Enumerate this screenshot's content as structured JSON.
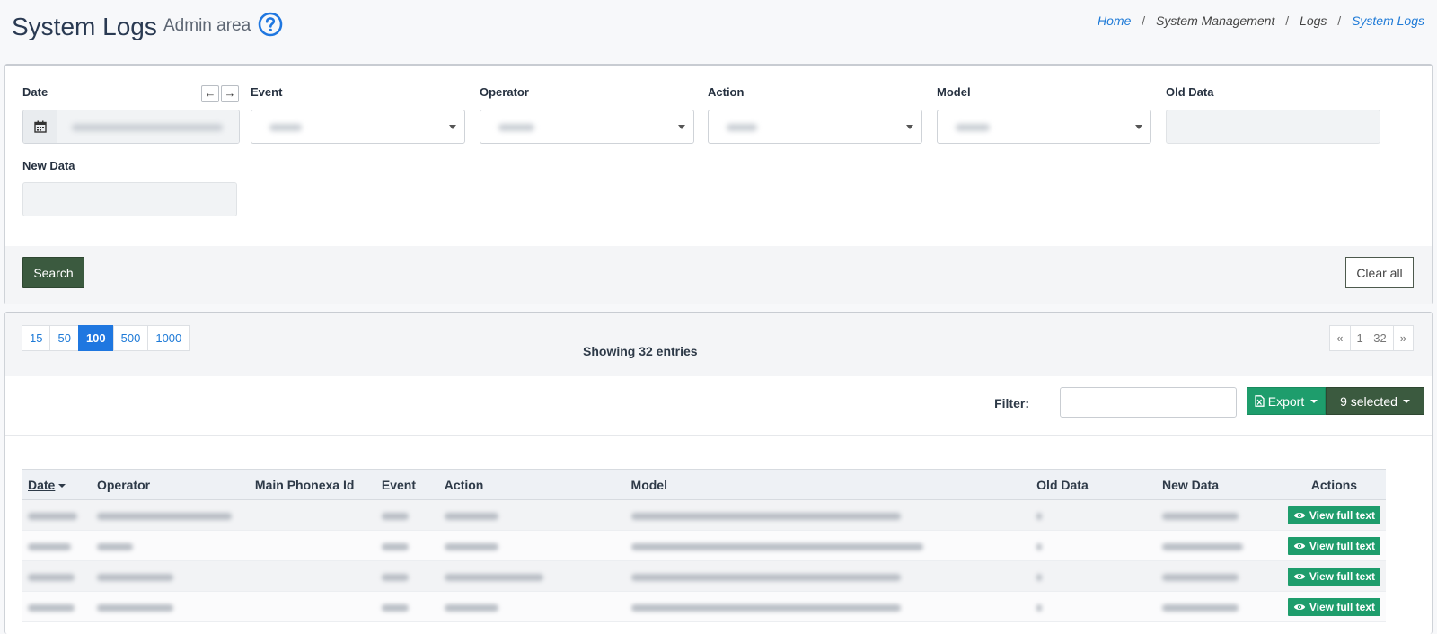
{
  "header": {
    "title": "System Logs",
    "subtitle": "Admin area",
    "breadcrumb": {
      "home": "Home",
      "sep": "/",
      "level1": "System Management",
      "level2": "Logs",
      "current": "System Logs"
    }
  },
  "filters": {
    "date_label": "Date",
    "event_label": "Event",
    "operator_label": "Operator",
    "action_label": "Action",
    "model_label": "Model",
    "old_data_label": "Old Data",
    "new_data_label": "New Data",
    "prev_arrow": "←",
    "next_arrow": "→",
    "search_label": "Search",
    "clear_label": "Clear all"
  },
  "results": {
    "page_sizes": [
      "15",
      "50",
      "100",
      "500",
      "1000"
    ],
    "active_page_size": "100",
    "showing": "Showing 32 entries",
    "pager": {
      "first": "«",
      "range": "1 - 32",
      "last": "»"
    },
    "filter_label": "Filter:",
    "export_label": "Export",
    "selected_label": "9 selected"
  },
  "table": {
    "columns": [
      "Date",
      "Operator",
      "Main Phonexa Id",
      "Event",
      "Action",
      "Model",
      "Old Data",
      "New Data",
      "Actions"
    ],
    "view_label": "View full text",
    "row_count": 4
  },
  "colors": {
    "accent_blue": "#1f77e0",
    "dark_green": "#3b5a3f",
    "green": "#1e9d6c"
  }
}
